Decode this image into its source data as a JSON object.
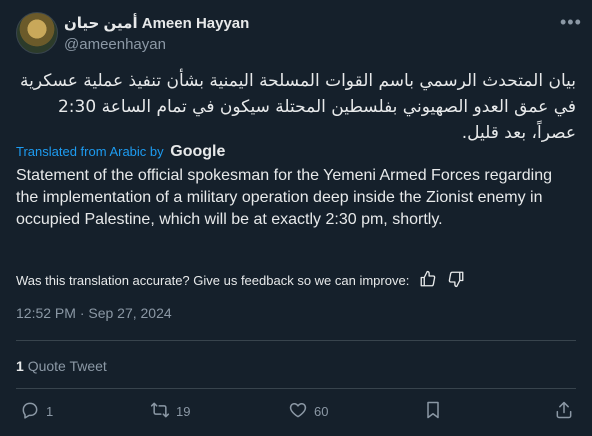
{
  "author": {
    "display_name": "أمين حيان Ameen Hayyan",
    "handle": "@ameenhayan"
  },
  "tweet": {
    "arabic_text": "بيان المتحدث الرسمي باسم القوات المسلحة اليمنية بشأن تنفيذ عملية عسكرية في عمق العدو الصهيوني بفلسطين المحتلة سيكون في تمام الساعة 2:30 عصراً، بعد قليل.",
    "translated_from": "Translated from Arabic by",
    "translator": "Google",
    "english_text": "Statement of the official spokesman for the Yemeni Armed Forces regarding the implementation of a military operation deep inside the Zionist enemy in occupied Palestine, which will be at exactly 2:30 pm, shortly.",
    "feedback_prompt": "Was this translation accurate? Give us feedback so we can improve:",
    "timestamp": "12:52 PM · Sep 27, 2024"
  },
  "quotes": {
    "count": "1",
    "label": "Quote Tweet"
  },
  "actions": {
    "replies": "1",
    "retweets": "19",
    "likes": "60"
  },
  "colors": {
    "background": "#15202b",
    "text": "#e7e9ea",
    "muted": "#8b98a5",
    "link": "#1d9bf0",
    "border": "#38444d"
  }
}
